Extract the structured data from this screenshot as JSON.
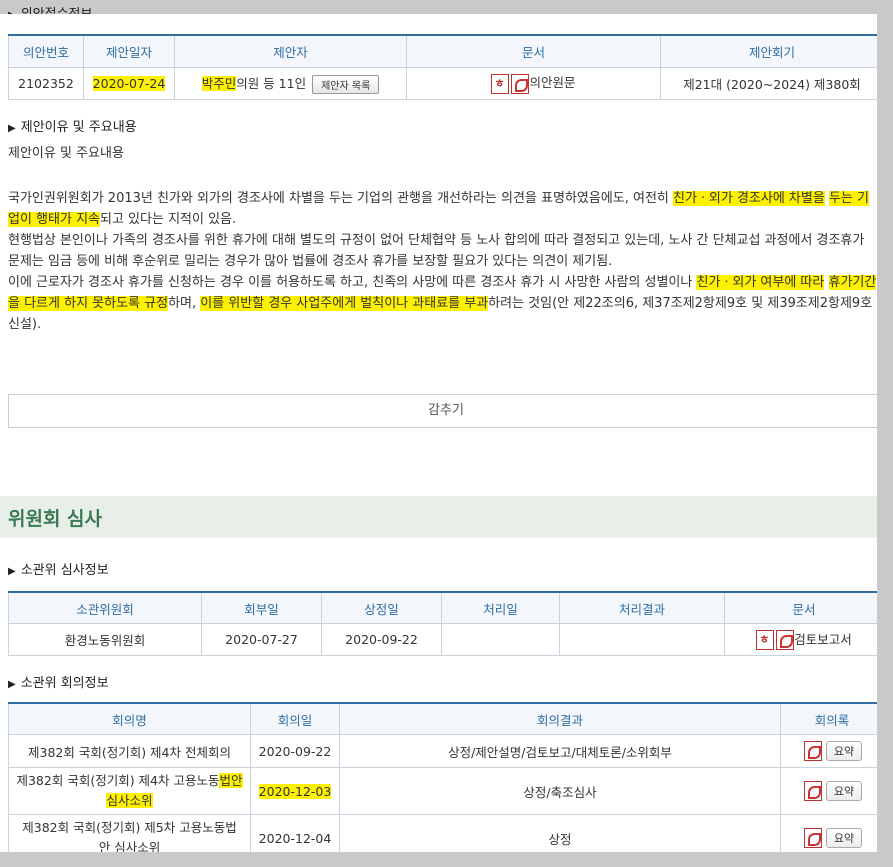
{
  "sections": {
    "receipt": "의안접수정보",
    "reason_head": "제안이유 및 주요내용",
    "reason_sub": "제안이유 및 주요내용",
    "committee_review": "위원회 심사",
    "committee_info": "소관위 심사정보",
    "meeting_info": "소관위 회의정보"
  },
  "receipt_table": {
    "headers": [
      "의안번호",
      "제안일자",
      "제안자",
      "문서",
      "제안회기"
    ],
    "row": {
      "bill_no": "2102352",
      "date": "2020-07-24",
      "proposer_name": "박주민",
      "proposer_rest": "의원 등 11인",
      "proposer_btn": "제안자 목록",
      "doc": "의안원문",
      "session": "제21대 (2020~2024) 제380회"
    }
  },
  "reason_text": {
    "p1_a": "국가인권위원회가 2013년 친가와 외가의 경조사에 차별을 두는 기업의 관행을 개선하라는 의견을 표명하였음에도, 여전히 ",
    "p1_hl1": "친가ㆍ외가 경조사에 차별을",
    "p1_hl2": "두는 기업이 행태가 지속",
    "p1_b": "되고 있다는 지적이 있음.",
    "p2": "현행법상 본인이나 가족의 경조사를 위한 휴가에 대해 별도의 규정이 없어 단체협약 등 노사 합의에 따라 결정되고 있는데, 노사 간 단체교섭 과정에서 경조휴가 문제는 임금 등에 비해 후순위로 밀리는 경우가 많아 법률에 경조사 휴가를 보장할 필요가 있다는 의견이 제기됨.",
    "p3_a": "이에 근로자가 경조사 휴가를 신청하는 경우 이를 허용하도록 하고, 친족의 사망에 따른 경조사 휴가 시 사망한 사람의 성별이나 ",
    "p3_hl1": "친가ㆍ외가 여부에 따라",
    "p3_hl2": "휴가기간을 다르게 하지 못하도록 규정",
    "p3_b": "하며, ",
    "p3_hl3": "이를 위반할 경우 사업주에게 벌칙이나 과태료를 부과",
    "p3_c": "하려는 것임(안 제22조의6, 제37조제2항제9호 및 제39조제2항제9호 신설)."
  },
  "hide_button": "감추기",
  "committee_table": {
    "headers": [
      "소관위원회",
      "회부일",
      "상정일",
      "처리일",
      "처리결과",
      "문서"
    ],
    "row": [
      "환경노동위원회",
      "2020-07-27",
      "2020-09-22",
      "",
      "",
      "검토보고서"
    ]
  },
  "meeting_table": {
    "headers": [
      "회의명",
      "회의일",
      "회의결과",
      "회의록"
    ],
    "rows": [
      {
        "name_a": "제382회 국회(정기회) 제4차 전체회의",
        "name_hl": "",
        "name_hl2": "",
        "date": "2020-09-22",
        "result": "상정/제안설명/검토보고/대체토론/소위회부",
        "summary": "요약"
      },
      {
        "name_a": "제382회 국회(정기회) 제4차 고용노동",
        "name_hl": "법안",
        "name_hl2": "심사소위",
        "date": "2020-12-03",
        "result": "상정/축조심사",
        "summary": "요약"
      },
      {
        "name_a": "제382회 국회(정기회) 제5차 고용노동법안 심사소위",
        "name_hl": "",
        "name_hl2": "",
        "date": "2020-12-04",
        "result": "상정",
        "summary": "요약"
      }
    ]
  },
  "colors": {
    "header_text": "#2f6da3",
    "highlight": "#fdf000",
    "section_band": "#e8efe9",
    "section_title": "#3b7a54"
  }
}
